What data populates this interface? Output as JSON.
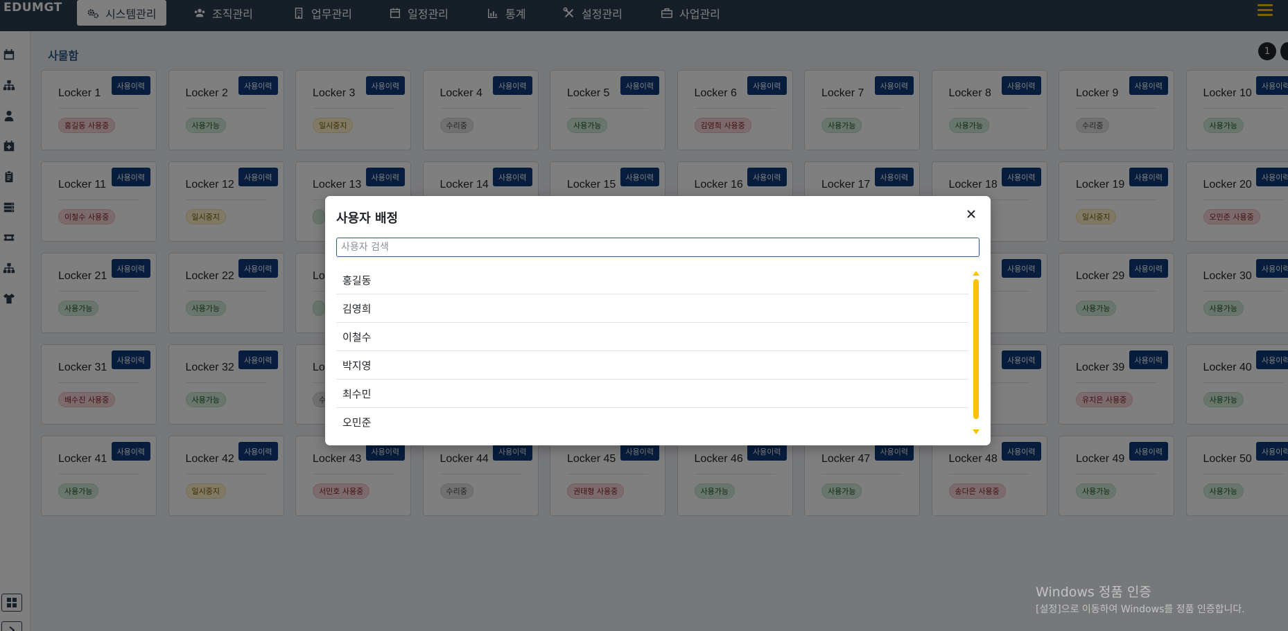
{
  "app": {
    "brand": "EDUMGT"
  },
  "nav": {
    "items": [
      {
        "label": "시스템관리",
        "icon": "gears-icon",
        "active": true
      },
      {
        "label": "조직관리",
        "icon": "users-icon",
        "active": false
      },
      {
        "label": "업무관리",
        "icon": "building-icon",
        "active": false
      },
      {
        "label": "일정관리",
        "icon": "calendar-icon",
        "active": false
      },
      {
        "label": "통계",
        "icon": "chart-icon",
        "active": false
      },
      {
        "label": "설정관리",
        "icon": "tools-icon",
        "active": false
      },
      {
        "label": "사업관리",
        "icon": "briefcase-icon",
        "active": false
      }
    ]
  },
  "sidebar": {
    "icons": [
      "calendar-icon",
      "sitemap-icon",
      "user-icon",
      "calendar-plus-icon",
      "clipboard-icon",
      "server-icon",
      "ticket-icon",
      "sitemap-icon",
      "shirt-icon"
    ],
    "bottom_icons": [
      "grid-icon",
      "chevron-right-icon"
    ]
  },
  "main": {
    "title": "사물함",
    "pages": [
      "1"
    ],
    "history_label": "사용이력",
    "lockers": [
      {
        "name": "Locker 1",
        "status": "홍길동 사용중",
        "type": "use"
      },
      {
        "name": "Locker 2",
        "status": "사용가능",
        "type": "ok"
      },
      {
        "name": "Locker 3",
        "status": "일시중지",
        "type": "pause"
      },
      {
        "name": "Locker 4",
        "status": "수리중",
        "type": "repair"
      },
      {
        "name": "Locker 5",
        "status": "사용가능",
        "type": "ok"
      },
      {
        "name": "Locker 6",
        "status": "김영희 사용중",
        "type": "use"
      },
      {
        "name": "Locker 7",
        "status": "사용가능",
        "type": "ok"
      },
      {
        "name": "Locker 8",
        "status": "사용가능",
        "type": "ok"
      },
      {
        "name": "Locker 9",
        "status": "수리중",
        "type": "repair"
      },
      {
        "name": "Locker 10",
        "status": "사용가능",
        "type": "ok"
      },
      {
        "name": "Locker 11",
        "status": "이철수 사용중",
        "type": "use"
      },
      {
        "name": "Locker 12",
        "status": "일시중지",
        "type": "pause"
      },
      {
        "name": "Locker 13",
        "status": "",
        "type": "ok"
      },
      {
        "name": "Locker 14",
        "status": "",
        "type": ""
      },
      {
        "name": "Locker 15",
        "status": "",
        "type": ""
      },
      {
        "name": "Locker 16",
        "status": "",
        "type": ""
      },
      {
        "name": "Locker 17",
        "status": "",
        "type": ""
      },
      {
        "name": "Locker 18",
        "status": "",
        "type": ""
      },
      {
        "name": "Locker 19",
        "status": "일시중지",
        "type": "pause"
      },
      {
        "name": "Locker 20",
        "status": "오민준 사용중",
        "type": "use"
      },
      {
        "name": "Locker 21",
        "status": "사용가능",
        "type": "ok"
      },
      {
        "name": "Locker 22",
        "status": "사용가능",
        "type": "ok"
      },
      {
        "name": "Lo",
        "status": "",
        "type": "ok"
      },
      {
        "name": "",
        "status": "",
        "type": ""
      },
      {
        "name": "",
        "status": "",
        "type": ""
      },
      {
        "name": "",
        "status": "",
        "type": ""
      },
      {
        "name": "",
        "status": "",
        "type": ""
      },
      {
        "name": "28",
        "status": "",
        "type": ""
      },
      {
        "name": "Locker 29",
        "status": "사용가능",
        "type": "ok"
      },
      {
        "name": "Locker 30",
        "status": "사용가능",
        "type": "ok"
      },
      {
        "name": "Locker 31",
        "status": "배수진 사용중",
        "type": "use"
      },
      {
        "name": "Locker 32",
        "status": "사용가능",
        "type": "ok"
      },
      {
        "name": "Lo",
        "status": "수",
        "type": "repair"
      },
      {
        "name": "",
        "status": "",
        "type": ""
      },
      {
        "name": "",
        "status": "",
        "type": ""
      },
      {
        "name": "",
        "status": "",
        "type": ""
      },
      {
        "name": "",
        "status": "",
        "type": ""
      },
      {
        "name": "38",
        "status": "",
        "type": ""
      },
      {
        "name": "Locker 39",
        "status": "유지은 사용중",
        "type": "use"
      },
      {
        "name": "Locker 40",
        "status": "사용가능",
        "type": "ok"
      },
      {
        "name": "Locker 41",
        "status": "사용가능",
        "type": "ok"
      },
      {
        "name": "Locker 42",
        "status": "일시중지",
        "type": "pause"
      },
      {
        "name": "Locker 43",
        "status": "서민호 사용중",
        "type": "use"
      },
      {
        "name": "Locker 44",
        "status": "수리중",
        "type": "repair"
      },
      {
        "name": "Locker 45",
        "status": "권태형 사용중",
        "type": "use"
      },
      {
        "name": "Locker 46",
        "status": "사용가능",
        "type": "ok"
      },
      {
        "name": "Locker 47",
        "status": "사용가능",
        "type": "ok"
      },
      {
        "name": "Locker 48",
        "status": "송다은 사용중",
        "type": "use"
      },
      {
        "name": "Locker 49",
        "status": "사용가능",
        "type": "ok"
      },
      {
        "name": "Locker 50",
        "status": "사용가능",
        "type": "ok"
      }
    ]
  },
  "modal": {
    "title": "사용자 배정",
    "close_icon": "close-icon",
    "search_placeholder": "사용자 검색",
    "search_value": "",
    "users": [
      "홍길동",
      "김영희",
      "이철수",
      "박지영",
      "최수민",
      "오민준"
    ]
  },
  "watermark": {
    "line1": "Windows 정품 인증",
    "line2": "[설정]으로 이동하여 Windows를 정품 인증합니다."
  },
  "colors": {
    "nav_bg": "#2c3e50",
    "accent": "#ffc107",
    "history_btn": "#0d3a7a",
    "title": "#2a5a8c"
  }
}
